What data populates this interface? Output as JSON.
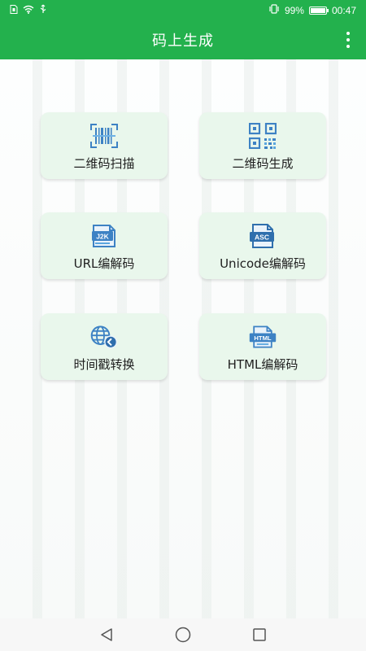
{
  "status_bar": {
    "left_icons": [
      "sim-icon",
      "wifi-icon",
      "usb-icon"
    ],
    "vibrate_icon": "vibrate-icon",
    "battery_percent_text": "99%",
    "battery_level": 0.99,
    "time": "00:47"
  },
  "app_bar": {
    "title": "码上生成",
    "menu_icon": "more-vertical-icon"
  },
  "cards": [
    {
      "label": "二维码扫描",
      "icon": "barcode-scan-icon"
    },
    {
      "label": "二维码生成",
      "icon": "qr-code-icon"
    },
    {
      "label": "URL编解码",
      "icon": "j2k-file-icon",
      "icon_text": "J2K"
    },
    {
      "label": "Unicode编解码",
      "icon": "asc-file-icon",
      "icon_text": "ASC"
    },
    {
      "label": "时间戳转换",
      "icon": "globe-clock-icon"
    },
    {
      "label": "HTML编解码",
      "icon": "html-file-icon",
      "icon_text": "HTML"
    }
  ],
  "nav_bar": {
    "back_icon": "back-triangle-icon",
    "home_icon": "home-circle-icon",
    "recents_icon": "recents-square-icon"
  },
  "colors": {
    "primary_green": "#23b14d",
    "card_bg": "#e9f7ec",
    "icon_blue": "#2f7fc1",
    "icon_blue_light": "#5aa6de"
  }
}
